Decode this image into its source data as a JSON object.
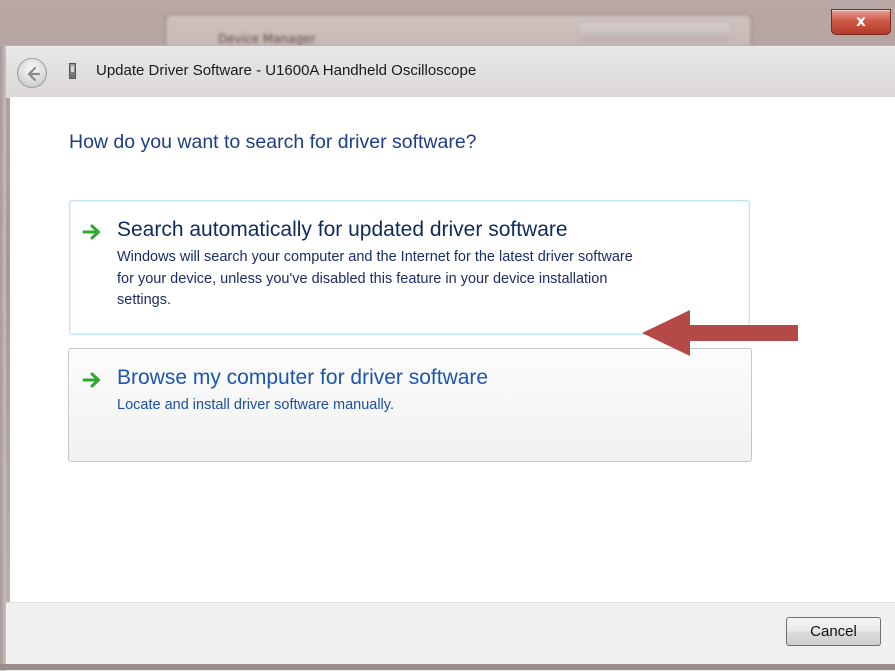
{
  "window": {
    "title": "Update Driver Software - U1600A Handheld Oscilloscope",
    "close_label": "x",
    "background_window_title": "Device Manager"
  },
  "icons": {
    "back": "back-arrow-icon",
    "device": "device-icon",
    "option_arrow": "green-arrow-icon",
    "annotation": "red-arrow-icon"
  },
  "main": {
    "heading": "How do you want to search for driver software?",
    "options": [
      {
        "title": "Search automatically for updated driver software",
        "description_lines": [
          "Windows will search your computer and the Internet for the latest driver software",
          "for your device, unless you've disabled this feature in your device installation",
          "settings."
        ]
      },
      {
        "title": "Browse my computer for driver software",
        "description_lines": [
          "Locate and install driver software manually."
        ]
      }
    ]
  },
  "footer": {
    "cancel_label": "Cancel"
  },
  "colors": {
    "heading": "#1f3c88",
    "link_blue": "#1c56b0",
    "arrow_green": "#2fa82f",
    "annotation_red": "#b34a46",
    "close_red": "#cf5a48"
  }
}
